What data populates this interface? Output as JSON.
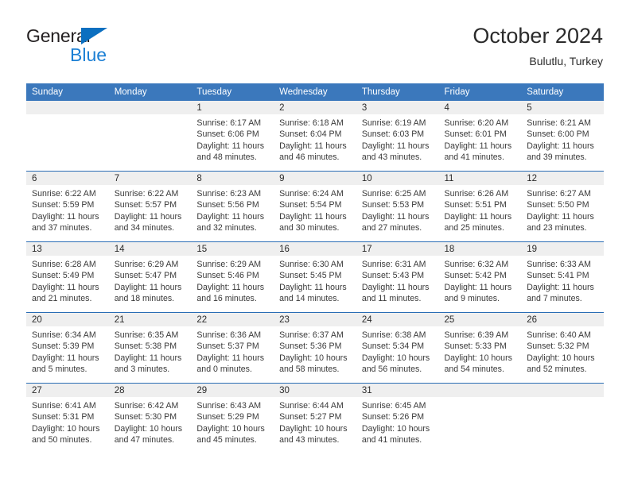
{
  "brand": {
    "name_top": "General",
    "name_bottom": "Blue",
    "triangle_color": "#0b6fc0",
    "blue_color": "#1b7fd4"
  },
  "header": {
    "title": "October 2024",
    "subtitle": "Bulutlu, Turkey"
  },
  "theme": {
    "header_blue": "#3b78bc",
    "divider_blue": "#2a6db5",
    "daynum_band": "#efefef"
  },
  "weekdays": [
    "Sunday",
    "Monday",
    "Tuesday",
    "Wednesday",
    "Thursday",
    "Friday",
    "Saturday"
  ],
  "weeks": [
    [
      {
        "day": "",
        "blank": true,
        "lines": []
      },
      {
        "day": "",
        "blank": true,
        "lines": []
      },
      {
        "day": "1",
        "lines": [
          "Sunrise: 6:17 AM",
          "Sunset: 6:06 PM",
          "Daylight: 11 hours and 48 minutes."
        ]
      },
      {
        "day": "2",
        "lines": [
          "Sunrise: 6:18 AM",
          "Sunset: 6:04 PM",
          "Daylight: 11 hours and 46 minutes."
        ]
      },
      {
        "day": "3",
        "lines": [
          "Sunrise: 6:19 AM",
          "Sunset: 6:03 PM",
          "Daylight: 11 hours and 43 minutes."
        ]
      },
      {
        "day": "4",
        "lines": [
          "Sunrise: 6:20 AM",
          "Sunset: 6:01 PM",
          "Daylight: 11 hours and 41 minutes."
        ]
      },
      {
        "day": "5",
        "lines": [
          "Sunrise: 6:21 AM",
          "Sunset: 6:00 PM",
          "Daylight: 11 hours and 39 minutes."
        ]
      }
    ],
    [
      {
        "day": "6",
        "lines": [
          "Sunrise: 6:22 AM",
          "Sunset: 5:59 PM",
          "Daylight: 11 hours and 37 minutes."
        ]
      },
      {
        "day": "7",
        "lines": [
          "Sunrise: 6:22 AM",
          "Sunset: 5:57 PM",
          "Daylight: 11 hours and 34 minutes."
        ]
      },
      {
        "day": "8",
        "lines": [
          "Sunrise: 6:23 AM",
          "Sunset: 5:56 PM",
          "Daylight: 11 hours and 32 minutes."
        ]
      },
      {
        "day": "9",
        "lines": [
          "Sunrise: 6:24 AM",
          "Sunset: 5:54 PM",
          "Daylight: 11 hours and 30 minutes."
        ]
      },
      {
        "day": "10",
        "lines": [
          "Sunrise: 6:25 AM",
          "Sunset: 5:53 PM",
          "Daylight: 11 hours and 27 minutes."
        ]
      },
      {
        "day": "11",
        "lines": [
          "Sunrise: 6:26 AM",
          "Sunset: 5:51 PM",
          "Daylight: 11 hours and 25 minutes."
        ]
      },
      {
        "day": "12",
        "lines": [
          "Sunrise: 6:27 AM",
          "Sunset: 5:50 PM",
          "Daylight: 11 hours and 23 minutes."
        ]
      }
    ],
    [
      {
        "day": "13",
        "lines": [
          "Sunrise: 6:28 AM",
          "Sunset: 5:49 PM",
          "Daylight: 11 hours and 21 minutes."
        ]
      },
      {
        "day": "14",
        "lines": [
          "Sunrise: 6:29 AM",
          "Sunset: 5:47 PM",
          "Daylight: 11 hours and 18 minutes."
        ]
      },
      {
        "day": "15",
        "lines": [
          "Sunrise: 6:29 AM",
          "Sunset: 5:46 PM",
          "Daylight: 11 hours and 16 minutes."
        ]
      },
      {
        "day": "16",
        "lines": [
          "Sunrise: 6:30 AM",
          "Sunset: 5:45 PM",
          "Daylight: 11 hours and 14 minutes."
        ]
      },
      {
        "day": "17",
        "lines": [
          "Sunrise: 6:31 AM",
          "Sunset: 5:43 PM",
          "Daylight: 11 hours and 11 minutes."
        ]
      },
      {
        "day": "18",
        "lines": [
          "Sunrise: 6:32 AM",
          "Sunset: 5:42 PM",
          "Daylight: 11 hours and 9 minutes."
        ]
      },
      {
        "day": "19",
        "lines": [
          "Sunrise: 6:33 AM",
          "Sunset: 5:41 PM",
          "Daylight: 11 hours and 7 minutes."
        ]
      }
    ],
    [
      {
        "day": "20",
        "lines": [
          "Sunrise: 6:34 AM",
          "Sunset: 5:39 PM",
          "Daylight: 11 hours and 5 minutes."
        ]
      },
      {
        "day": "21",
        "lines": [
          "Sunrise: 6:35 AM",
          "Sunset: 5:38 PM",
          "Daylight: 11 hours and 3 minutes."
        ]
      },
      {
        "day": "22",
        "lines": [
          "Sunrise: 6:36 AM",
          "Sunset: 5:37 PM",
          "Daylight: 11 hours and 0 minutes."
        ]
      },
      {
        "day": "23",
        "lines": [
          "Sunrise: 6:37 AM",
          "Sunset: 5:36 PM",
          "Daylight: 10 hours and 58 minutes."
        ]
      },
      {
        "day": "24",
        "lines": [
          "Sunrise: 6:38 AM",
          "Sunset: 5:34 PM",
          "Daylight: 10 hours and 56 minutes."
        ]
      },
      {
        "day": "25",
        "lines": [
          "Sunrise: 6:39 AM",
          "Sunset: 5:33 PM",
          "Daylight: 10 hours and 54 minutes."
        ]
      },
      {
        "day": "26",
        "lines": [
          "Sunrise: 6:40 AM",
          "Sunset: 5:32 PM",
          "Daylight: 10 hours and 52 minutes."
        ]
      }
    ],
    [
      {
        "day": "27",
        "lines": [
          "Sunrise: 6:41 AM",
          "Sunset: 5:31 PM",
          "Daylight: 10 hours and 50 minutes."
        ]
      },
      {
        "day": "28",
        "lines": [
          "Sunrise: 6:42 AM",
          "Sunset: 5:30 PM",
          "Daylight: 10 hours and 47 minutes."
        ]
      },
      {
        "day": "29",
        "lines": [
          "Sunrise: 6:43 AM",
          "Sunset: 5:29 PM",
          "Daylight: 10 hours and 45 minutes."
        ]
      },
      {
        "day": "30",
        "lines": [
          "Sunrise: 6:44 AM",
          "Sunset: 5:27 PM",
          "Daylight: 10 hours and 43 minutes."
        ]
      },
      {
        "day": "31",
        "lines": [
          "Sunrise: 6:45 AM",
          "Sunset: 5:26 PM",
          "Daylight: 10 hours and 41 minutes."
        ]
      },
      {
        "day": "",
        "blank": true,
        "lines": []
      },
      {
        "day": "",
        "blank": true,
        "lines": []
      }
    ]
  ]
}
